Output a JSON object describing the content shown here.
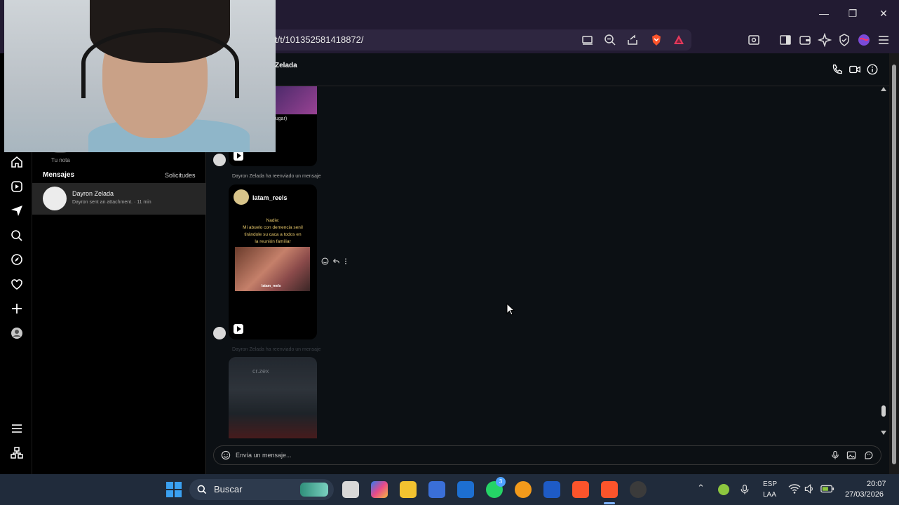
{
  "browser": {
    "url": "t/t/101352581418872/",
    "window_controls": {
      "minimize": "—",
      "restore": "❐",
      "close": "✕"
    }
  },
  "sidebar": {
    "note_label": "Tu nota",
    "messages_heading": "Mensajes",
    "requests_link": "Solicitudes",
    "conversations": [
      {
        "name": "Dayron Zelada",
        "preview": "Dayron sent an attachment. · 11 min"
      }
    ]
  },
  "chat": {
    "header_name": "Zelada",
    "top_caption": "so jugar)",
    "forward_notice_1": "Dayron Zelada ha reenviado un mensaje",
    "forward_notice_2": "Dayron Zelada ha reenviado un mensaje",
    "reel": {
      "account": "latam_reels",
      "line1": "Nadie:",
      "line2": "Mi abuelo con demencia senil",
      "line3": "tirándole su caca a todos en",
      "line4": "la reunión familiar",
      "watermark": "latam_reels"
    },
    "third_card_text": "cr.zex",
    "composer_placeholder": "Envía un mensaje..."
  },
  "taskbar": {
    "search_label": "Buscar",
    "whatsapp_badge": "3",
    "lang_line1": "ESP",
    "lang_line2": "LAA",
    "time": "20:07",
    "date": "27/03/2026"
  },
  "colors": {
    "titlebar": "#221b32",
    "app_bg": "#000000",
    "chat_bg": "#0c1014",
    "taskbar": "#202b3b"
  }
}
